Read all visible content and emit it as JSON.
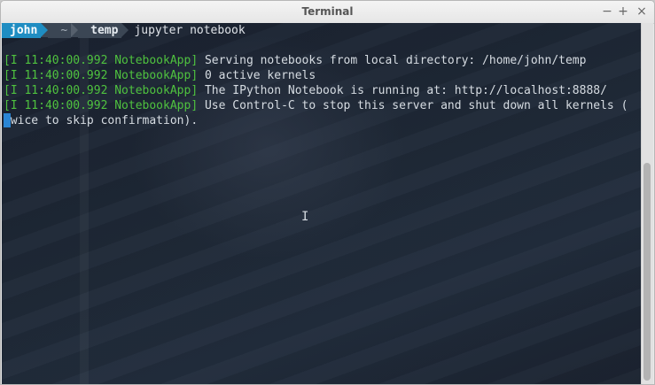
{
  "window": {
    "title": "Terminal",
    "minimize": "−",
    "maximize": "+",
    "close": "×"
  },
  "prompt": {
    "user": "john",
    "home": "~",
    "dir": "temp",
    "command": "jupyter notebook"
  },
  "lines": [
    {
      "tag": "[I 11:40:00.992 NotebookApp]",
      "text": " Serving notebooks from local directory: /home/john/temp"
    },
    {
      "tag": "[I 11:40:00.992 NotebookApp]",
      "text": " 0 active kernels"
    },
    {
      "tag": "[I 11:40:00.992 NotebookApp]",
      "text": " The IPython Notebook is running at: http://localhost:8888/"
    },
    {
      "tag": "[I 11:40:00.992 NotebookApp]",
      "text": " Use Control-C to stop this server and shut down all kernels ("
    },
    {
      "tag": "",
      "text": "twice to skip confirmation)."
    }
  ],
  "colors": {
    "accent_user": "#1f8dc2",
    "log_tag": "#4fc23f",
    "cursor": "#2a86d4"
  },
  "icons": {
    "mouse_cursor": "I"
  }
}
